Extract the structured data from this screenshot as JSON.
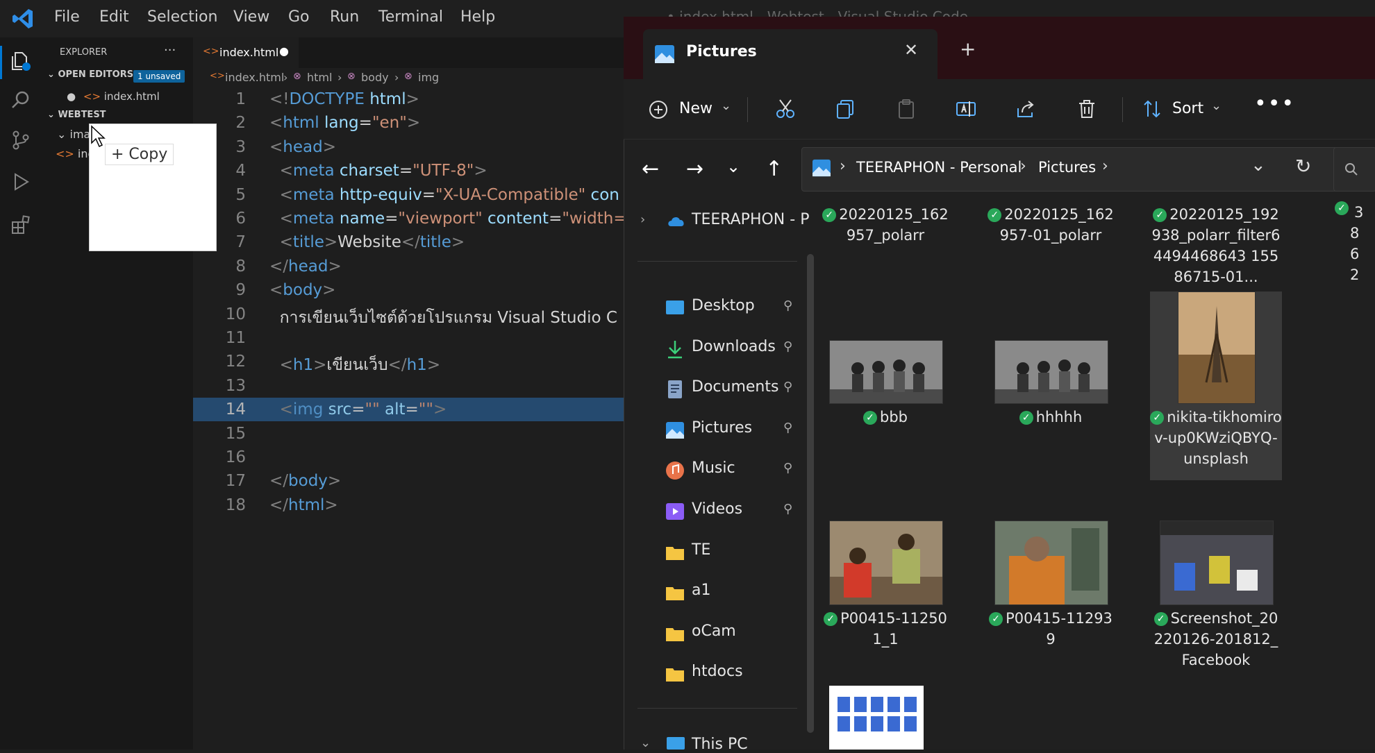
{
  "vscode": {
    "menu": [
      "File",
      "Edit",
      "Selection",
      "View",
      "Go",
      "Run",
      "Terminal",
      "Help"
    ],
    "window_title": "• index.html - Webtest - Visual Studio Code",
    "explorer_label": "EXPLORER",
    "open_editors_label": "OPEN EDITORS",
    "unsaved_badge": "1 unsaved",
    "open_file": "index.html",
    "workspace_label": "WEBTEST",
    "tree_folder": "ima",
    "tree_file": "ind",
    "drag_tooltip": "+ Copy",
    "tab_label": "index.html",
    "breadcrumb": [
      "index.html",
      "html",
      "body",
      "img"
    ],
    "code_lines": [
      {
        "n": "1",
        "parts": [
          [
            "t",
            "<!"
          ],
          [
            "tag",
            "DOCTYPE"
          ],
          [
            "txt",
            " "
          ],
          [
            "attr",
            "html"
          ],
          [
            "t",
            ">"
          ]
        ]
      },
      {
        "n": "2",
        "parts": [
          [
            "t",
            "<"
          ],
          [
            "tag",
            "html"
          ],
          [
            "txt",
            " "
          ],
          [
            "attr",
            "lang"
          ],
          [
            "txt",
            "="
          ],
          [
            "str",
            "\"en\""
          ],
          [
            "t",
            ">"
          ]
        ]
      },
      {
        "n": "3",
        "parts": [
          [
            "t",
            "<"
          ],
          [
            "tag",
            "head"
          ],
          [
            "t",
            ">"
          ]
        ]
      },
      {
        "n": "4",
        "parts": [
          [
            "txt",
            "  "
          ],
          [
            "t",
            "<"
          ],
          [
            "tag",
            "meta"
          ],
          [
            "txt",
            " "
          ],
          [
            "attr",
            "charset"
          ],
          [
            "txt",
            "="
          ],
          [
            "str",
            "\"UTF-8\""
          ],
          [
            "t",
            ">"
          ]
        ]
      },
      {
        "n": "5",
        "parts": [
          [
            "txt",
            "  "
          ],
          [
            "t",
            "<"
          ],
          [
            "tag",
            "meta"
          ],
          [
            "txt",
            " "
          ],
          [
            "attr",
            "http-equiv"
          ],
          [
            "txt",
            "="
          ],
          [
            "str",
            "\"X-UA-Compatible\""
          ],
          [
            "txt",
            " "
          ],
          [
            "attr",
            "con"
          ]
        ]
      },
      {
        "n": "6",
        "parts": [
          [
            "txt",
            "  "
          ],
          [
            "t",
            "<"
          ],
          [
            "tag",
            "meta"
          ],
          [
            "txt",
            " "
          ],
          [
            "attr",
            "name"
          ],
          [
            "txt",
            "="
          ],
          [
            "str",
            "\"viewport\""
          ],
          [
            "txt",
            " "
          ],
          [
            "attr",
            "content"
          ],
          [
            "txt",
            "="
          ],
          [
            "str",
            "\"width=c"
          ]
        ]
      },
      {
        "n": "7",
        "parts": [
          [
            "txt",
            "  "
          ],
          [
            "t",
            "<"
          ],
          [
            "tag",
            "title"
          ],
          [
            "t",
            ">"
          ],
          [
            "txt",
            "Website"
          ],
          [
            "t",
            "</"
          ],
          [
            "tag",
            "title"
          ],
          [
            "t",
            ">"
          ]
        ]
      },
      {
        "n": "8",
        "parts": [
          [
            "t",
            "</"
          ],
          [
            "tag",
            "head"
          ],
          [
            "t",
            ">"
          ]
        ]
      },
      {
        "n": "9",
        "parts": [
          [
            "t",
            "<"
          ],
          [
            "tag",
            "body"
          ],
          [
            "t",
            ">"
          ]
        ]
      },
      {
        "n": "10",
        "parts": [
          [
            "txt",
            "  การเขียนเว็บไซต์ด้วยโปรแกรม Visual Studio C"
          ]
        ]
      },
      {
        "n": "11",
        "parts": []
      },
      {
        "n": "12",
        "parts": [
          [
            "txt",
            "  "
          ],
          [
            "t",
            "<"
          ],
          [
            "tag",
            "h1"
          ],
          [
            "t",
            ">"
          ],
          [
            "txt",
            "เขียนเว็บ"
          ],
          [
            "t",
            "</"
          ],
          [
            "tag",
            "h1"
          ],
          [
            "t",
            ">"
          ]
        ]
      },
      {
        "n": "13",
        "parts": []
      },
      {
        "n": "14",
        "parts": [
          [
            "txt",
            "  "
          ],
          [
            "t",
            "<"
          ],
          [
            "tag",
            "img"
          ],
          [
            "txt",
            " "
          ],
          [
            "attr",
            "src"
          ],
          [
            "txt",
            "="
          ],
          [
            "str",
            "\"\""
          ],
          [
            "txt",
            " "
          ],
          [
            "attr",
            "alt"
          ],
          [
            "txt",
            "="
          ],
          [
            "str",
            "\"\""
          ],
          [
            "t",
            ">"
          ]
        ]
      },
      {
        "n": "15",
        "parts": []
      },
      {
        "n": "16",
        "parts": []
      },
      {
        "n": "17",
        "parts": [
          [
            "t",
            "</"
          ],
          [
            "tag",
            "body"
          ],
          [
            "t",
            ">"
          ]
        ]
      },
      {
        "n": "18",
        "parts": [
          [
            "t",
            "</"
          ],
          [
            "tag",
            "html"
          ],
          [
            "t",
            ">"
          ]
        ]
      }
    ],
    "active_line": "14"
  },
  "explorer": {
    "tab_title": "Pictures",
    "toolbar": {
      "new_label": "New",
      "sort_label": "Sort"
    },
    "address": [
      "TEERAPHON - Personal",
      "Pictures"
    ],
    "nav_cloud": "TEERAPHON - P",
    "nav_items": [
      {
        "label": "Desktop",
        "icon": "desktop-icon",
        "pinned": true
      },
      {
        "label": "Downloads",
        "icon": "downloads-icon",
        "pinned": true
      },
      {
        "label": "Documents",
        "icon": "documents-icon",
        "pinned": true
      },
      {
        "label": "Pictures",
        "icon": "pictures-icon",
        "pinned": true
      },
      {
        "label": "Music",
        "icon": "music-icon",
        "pinned": true
      },
      {
        "label": "Videos",
        "icon": "videos-icon",
        "pinned": true
      },
      {
        "label": "TE",
        "icon": "folder-icon",
        "pinned": false
      },
      {
        "label": "a1",
        "icon": "folder-icon",
        "pinned": false
      },
      {
        "label": "oCam",
        "icon": "folder-icon",
        "pinned": false
      },
      {
        "label": "htdocs",
        "icon": "folder-icon",
        "pinned": false
      }
    ],
    "this_pc": "This PC",
    "files": [
      {
        "name": "20220125_162957_polarr",
        "thumb": "none"
      },
      {
        "name": "20220125_162957-01_polarr",
        "thumb": "none"
      },
      {
        "name": "20220125_192938_polarr_filter64494468643 15586715-01...",
        "thumb": "none"
      },
      {
        "name": "bbb",
        "thumb": "group-photo"
      },
      {
        "name": "hhhhh",
        "thumb": "group-photo"
      },
      {
        "name": "nikita-tikhomirov-up0KWziQBYQ-unsplash",
        "thumb": "eiffel"
      },
      {
        "name": "P00415-112501_1",
        "thumb": "kids"
      },
      {
        "name": "P00415-112939",
        "thumb": "elder"
      },
      {
        "name": "Screenshot_20220126-201812_Facebook",
        "thumb": "screenshot"
      }
    ],
    "partial_col_chars": [
      "3",
      "8",
      "6",
      "2"
    ]
  }
}
